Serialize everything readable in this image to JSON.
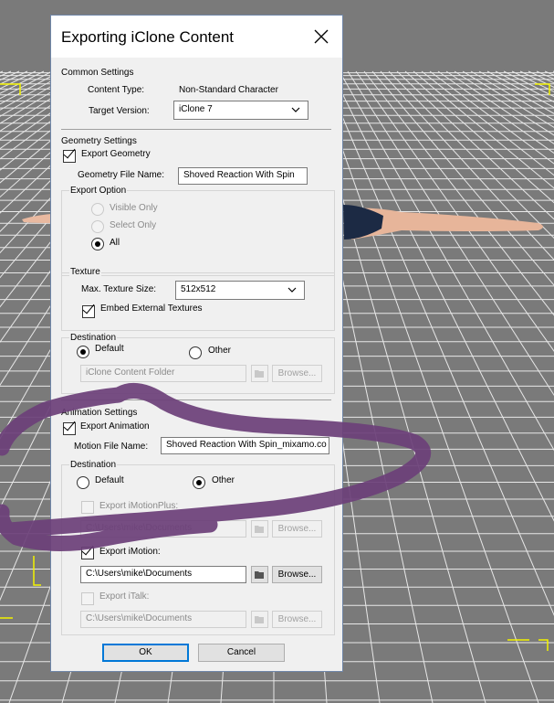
{
  "dialog": {
    "title": "Exporting iClone Content",
    "common": {
      "heading": "Common Settings",
      "content_type_label": "Content Type:",
      "content_type_value": "Non-Standard Character",
      "target_version_label": "Target Version:",
      "target_version_value": "iClone 7"
    },
    "geometry": {
      "heading": "Geometry Settings",
      "export_geometry_label": "Export Geometry",
      "file_name_label": "Geometry File Name:",
      "file_name_value": "Shoved Reaction With Spin",
      "export_option": {
        "heading": "Export Option",
        "visible_only": "Visible Only",
        "select_only": "Select Only",
        "all": "All"
      },
      "texture": {
        "heading": "Texture",
        "max_size_label": "Max. Texture Size:",
        "max_size_value": "512x512",
        "embed_label": "Embed External Textures"
      },
      "destination": {
        "heading": "Destination",
        "default_label": "Default",
        "other_label": "Other",
        "folder_value": "iClone Content Folder",
        "browse_label": "Browse..."
      }
    },
    "animation": {
      "heading": "Animation Settings",
      "export_animation_label": "Export Animation",
      "motion_file_label": "Motion File Name:",
      "motion_file_value": "Shoved Reaction With Spin_mixamo.co",
      "destination": {
        "heading": "Destination",
        "default_label": "Default",
        "other_label": "Other",
        "imotionplus_label": "Export iMotionPlus:",
        "imotionplus_path": "C:\\Users\\mike\\Documents",
        "imotion_label": "Export iMotion:",
        "imotion_path": "C:\\Users\\mike\\Documents",
        "italk_label": "Export iTalk:",
        "italk_path": "C:\\Users\\mike\\Documents",
        "browse_label": "Browse..."
      }
    },
    "ok_label": "OK",
    "cancel_label": "Cancel"
  },
  "colors": {
    "viewport_bg": "#7a7a7a",
    "grid_line": "#e8e8e8",
    "scribble": "#6b3f78",
    "default_button_border": "#0078d7"
  }
}
